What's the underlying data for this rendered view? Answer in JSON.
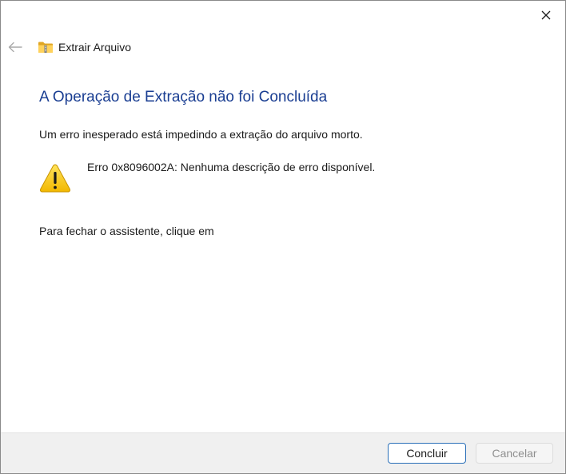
{
  "window": {
    "app_title": "Extrair Arquivo",
    "close_symbol": "✕"
  },
  "content": {
    "title": "A Operação de Extração não foi Concluída",
    "message": "Um erro inesperado está impedindo a extração do arquivo morto.",
    "error_detail": "Erro 0x8096002A: Nenhuma descrição de erro disponível.",
    "close_instruction": "Para fechar o assistente, clique em"
  },
  "footer": {
    "finish_label": "Concluir",
    "cancel_label": "Cancelar"
  },
  "icons": {
    "back": "arrow-left-icon",
    "app": "zip-folder-icon",
    "warning": "warning-icon",
    "close": "close-icon"
  },
  "colors": {
    "title_blue": "#1a3e92",
    "warning_yellow": "#f7c600",
    "focus_border": "#2a6fb8"
  }
}
